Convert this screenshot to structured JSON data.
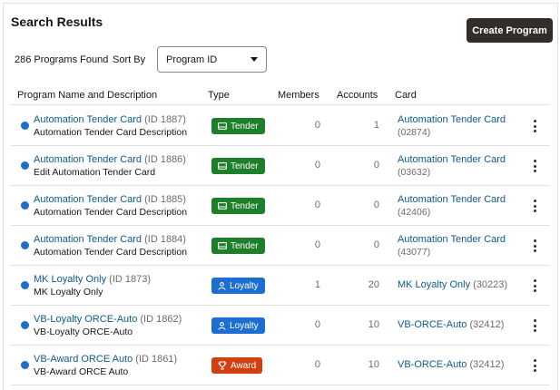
{
  "header": {
    "title": "Search Results",
    "create_label": "Create Program"
  },
  "toolbar": {
    "found_text": "286 Programs Found",
    "sort_label": "Sort By",
    "sort_value": "Program ID"
  },
  "columns": {
    "name": "Program Name and Description",
    "type": "Type",
    "members": "Members",
    "accounts": "Accounts",
    "card": "Card"
  },
  "rows": [
    {
      "name": "Automation Tender Card",
      "id": "(ID 1887)",
      "desc": "Automation Tender Card Description",
      "type": "Tender",
      "type_icon": "card-icon",
      "members": "0",
      "accounts": "1",
      "card_name": "Automation Tender Card",
      "card_num": "(02874)"
    },
    {
      "name": "Automation Tender Card",
      "id": "(ID 1886)",
      "desc": "Edit Automation Tender Card",
      "type": "Tender",
      "type_icon": "card-icon",
      "members": "0",
      "accounts": "0",
      "card_name": "Automation Tender Card",
      "card_num": "(03632)"
    },
    {
      "name": "Automation Tender Card",
      "id": "(ID 1885)",
      "desc": "Automation Tender Card Description",
      "type": "Tender",
      "type_icon": "card-icon",
      "members": "0",
      "accounts": "0",
      "card_name": "Automation Tender Card",
      "card_num": "(42406)"
    },
    {
      "name": "Automation Tender Card",
      "id": "(ID 1884)",
      "desc": "Automation Tender Card Description",
      "type": "Tender",
      "type_icon": "card-icon",
      "members": "0",
      "accounts": "0",
      "card_name": "Automation Tender Card",
      "card_num": "(43077)"
    },
    {
      "name": "MK Loyalty Only",
      "id": "(ID 1873)",
      "desc": "MK Loyalty Only",
      "type": "Loyalty",
      "type_icon": "person-icon",
      "members": "1",
      "accounts": "20",
      "card_name": "MK Loyalty Only",
      "card_num": "(30223)"
    },
    {
      "name": "VB-Loyalty ORCE-Auto",
      "id": "(ID 1862)",
      "desc": "VB-Loyalty ORCE-Auto",
      "type": "Loyalty",
      "type_icon": "person-icon",
      "members": "0",
      "accounts": "10",
      "card_name": "VB-ORCE-Auto",
      "card_num": "(32412)"
    },
    {
      "name": "VB-Award ORCE Auto",
      "id": "(ID 1861)",
      "desc": "VB-Award ORCE Auto",
      "type": "Award",
      "type_icon": "trophy-icon",
      "members": "0",
      "accounts": "10",
      "card_name": "VB-ORCE-Auto",
      "card_num": "(32412)"
    }
  ],
  "colors": {
    "tender": "#1e7f2a",
    "loyalty": "#1c6fd1",
    "award": "#d2400f",
    "link": "#0f5b8c",
    "button": "#312d2a"
  }
}
